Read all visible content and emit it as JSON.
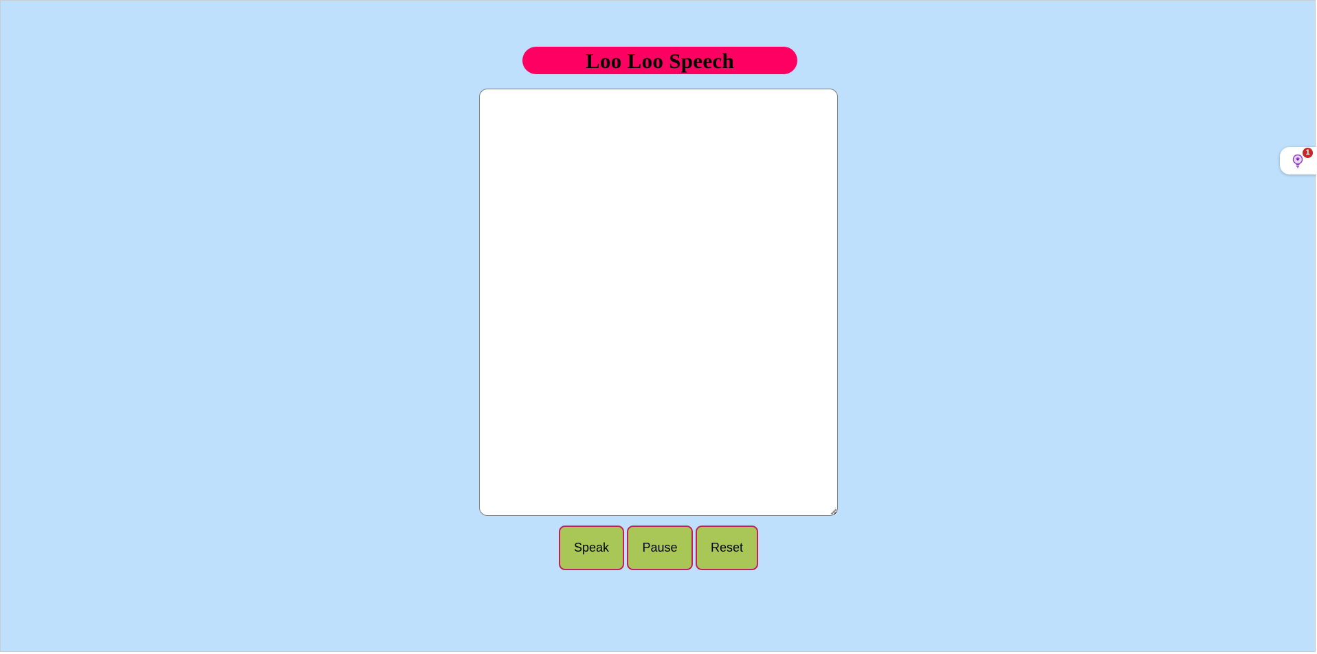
{
  "app": {
    "title": "Loo Loo Speech"
  },
  "editor": {
    "value": "",
    "placeholder": ""
  },
  "controls": {
    "speak_label": "Speak",
    "pause_label": "Pause",
    "reset_label": "Reset"
  },
  "extension": {
    "icon": "lightbulb-brain-icon",
    "badge_count": "1"
  },
  "colors": {
    "page_background": "#bee0fd",
    "title_background": "#fe0062",
    "button_background": "#a8c756",
    "button_border": "#c41e5b",
    "badge": "#c62828"
  }
}
